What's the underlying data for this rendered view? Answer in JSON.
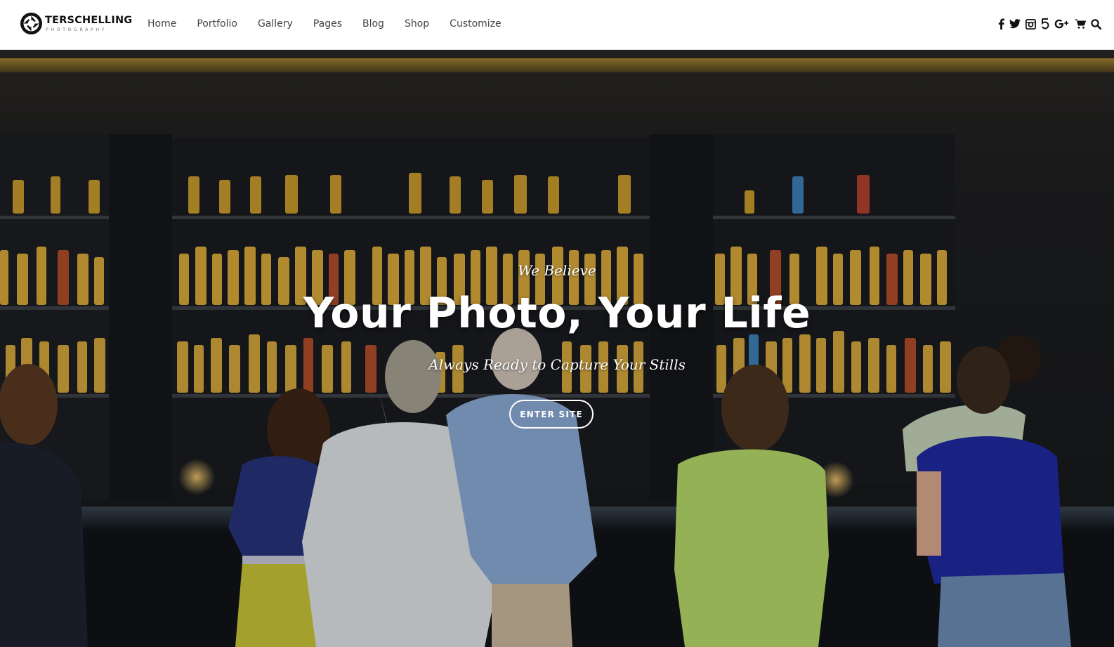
{
  "brand": {
    "name": "TERSCHELLING",
    "sub": "PHOTOGRAPHY"
  },
  "nav": {
    "items": [
      "Home",
      "Portfolio",
      "Gallery",
      "Pages",
      "Blog",
      "Shop",
      "Customize"
    ]
  },
  "social": {
    "icons": [
      "facebook-icon",
      "twitter-icon",
      "instagram-icon",
      "500px-icon",
      "google-plus-icon",
      "cart-icon",
      "search-icon"
    ]
  },
  "hero": {
    "eyebrow": "We Believe",
    "headline": "Your Photo, Your Life",
    "tagline": "Always Ready to Capture Your Stills",
    "button": "ENTER SITE"
  },
  "colors": {
    "header_bg": "#ffffff",
    "nav_text": "#444444",
    "hero_text": "#ffffff"
  }
}
